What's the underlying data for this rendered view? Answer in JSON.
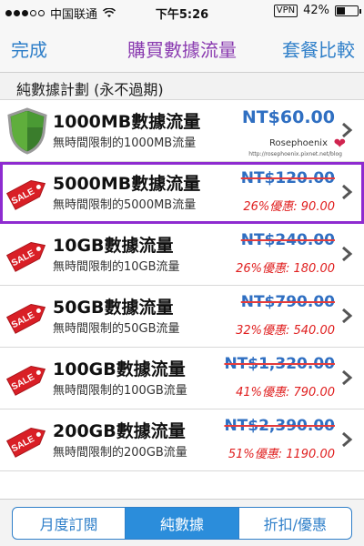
{
  "status_bar": {
    "carrier": "中国联通",
    "time": "下午5:26",
    "vpn": "VPN",
    "battery_percent": "42%",
    "battery_level": 0.42
  },
  "nav": {
    "left_button": "完成",
    "title": "購買數據流量",
    "right_button": "套餐比較"
  },
  "section": {
    "header": "純數據計劃 (永不過期)"
  },
  "watermark": {
    "name": "Rosephoenix",
    "url": "http://rosephoenix.pixnet.net/blog"
  },
  "plans": [
    {
      "title": "1000MB數據流量",
      "subtitle": "無時間限制的1000MB流量",
      "price": "NT$60.00",
      "old_price": "",
      "discount": "",
      "icon": "shield-icon"
    },
    {
      "title": "5000MB數據流量",
      "subtitle": "無時間限制的5000MB流量",
      "price": "",
      "old_price": "NT$120.00",
      "discount": "26%優惠: 90.00",
      "icon": "sale-tag-icon"
    },
    {
      "title": "10GB數據流量",
      "subtitle": "無時間限制的10GB流量",
      "price": "",
      "old_price": "NT$240.00",
      "discount": "26%優惠: 180.00",
      "icon": "sale-tag-icon"
    },
    {
      "title": "50GB數據流量",
      "subtitle": "無時間限制的50GB流量",
      "price": "",
      "old_price": "NT$790.00",
      "discount": "32%優惠: 540.00",
      "icon": "sale-tag-icon"
    },
    {
      "title": "100GB數據流量",
      "subtitle": "無時間限制的100GB流量",
      "price": "",
      "old_price": "NT$1,320.00",
      "discount": "41%優惠: 790.00",
      "icon": "sale-tag-icon"
    },
    {
      "title": "200GB數據流量",
      "subtitle": "無時間限制的200GB流量",
      "price": "",
      "old_price": "NT$2,390.00",
      "discount": "51%優惠: 1190.00",
      "icon": "sale-tag-icon"
    }
  ],
  "sale_label": "SALE",
  "tabs": [
    {
      "label": "月度訂閱",
      "active": false
    },
    {
      "label": "純數據",
      "active": true
    },
    {
      "label": "折扣/優惠",
      "active": false
    }
  ],
  "colors": {
    "accent": "#2f7fc9",
    "title_purple": "#8a3bb0",
    "price_blue": "#2f6fc2",
    "discount_red": "#e02020",
    "highlight_outline": "#8e2bd0"
  }
}
